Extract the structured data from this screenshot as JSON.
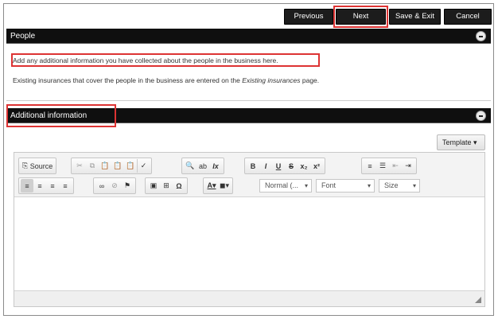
{
  "topbar": {
    "previous": "Previous",
    "next": "Next",
    "save_exit": "Save & Exit",
    "cancel": "Cancel"
  },
  "people": {
    "title": "People",
    "line1": "Add any additional information you have collected about the people in the business here.",
    "line2_pre": "Existing insurances that cover the people in the business are entered on the",
    "line2_link": "Existing insurances",
    "line2_post": "page."
  },
  "additional": {
    "title": "Additional information",
    "template_label": "Template ▾"
  },
  "editor": {
    "source_label": "Source",
    "format_combo": "Normal (...",
    "font_combo": "Font",
    "size_combo": "Size",
    "body_text": ""
  },
  "colors": {
    "header_bg": "#0f0f0f",
    "button_bg": "#1c1c1c",
    "highlight": "#dd3333"
  }
}
